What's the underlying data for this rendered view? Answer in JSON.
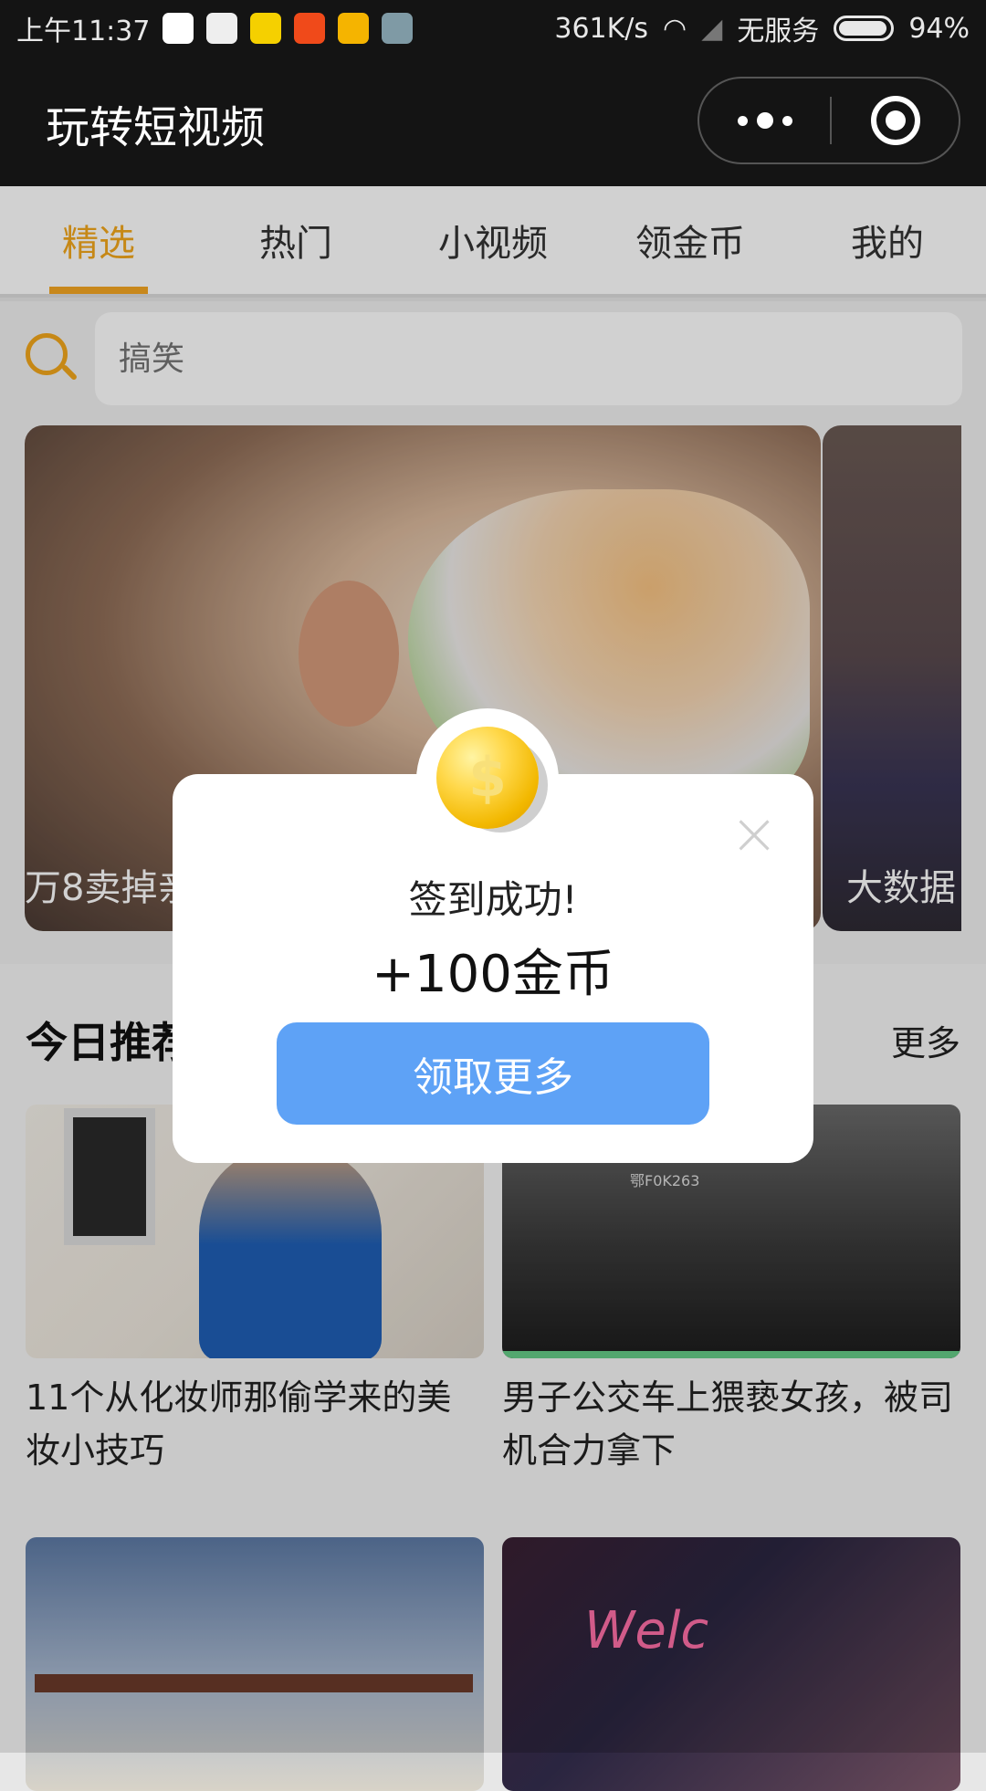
{
  "status_bar": {
    "time": "上午11:37",
    "network_speed": "361K/s",
    "carrier": "无服务",
    "battery": "94%",
    "app_icons": [
      "maps-icon",
      "play-store-icon",
      "news-icon",
      "video-icon",
      "weibo-icon",
      "notes-icon"
    ]
  },
  "header": {
    "title": "玩转短视频"
  },
  "tabs": [
    {
      "label": "精选",
      "active": true
    },
    {
      "label": "热门",
      "active": false
    },
    {
      "label": "小视频",
      "active": false
    },
    {
      "label": "领金币",
      "active": false
    },
    {
      "label": "我的",
      "active": false
    }
  ],
  "search": {
    "placeholder": "搞笑"
  },
  "banner": {
    "main_caption": "万8卖掉亲",
    "side_caption": "大数据"
  },
  "recommend": {
    "title": "今日推荐",
    "more_label": "更多",
    "cards": [
      {
        "title": "11个从化妆师那偷学来的美妆小技巧"
      },
      {
        "title": "男子公交车上猥亵女孩，被司机合力拿下"
      },
      {
        "title": ""
      },
      {
        "title": ""
      }
    ]
  },
  "thumb_labels": {
    "bus_plate": "鄂F0K263",
    "neon_sign": "Welc"
  },
  "modal": {
    "title": "签到成功!",
    "reward": "+100金币",
    "button_label": "领取更多",
    "coin_symbol": "$"
  },
  "colors": {
    "accent": "#f5a623",
    "button": "#5ea2f6",
    "header_bg": "#141414"
  }
}
